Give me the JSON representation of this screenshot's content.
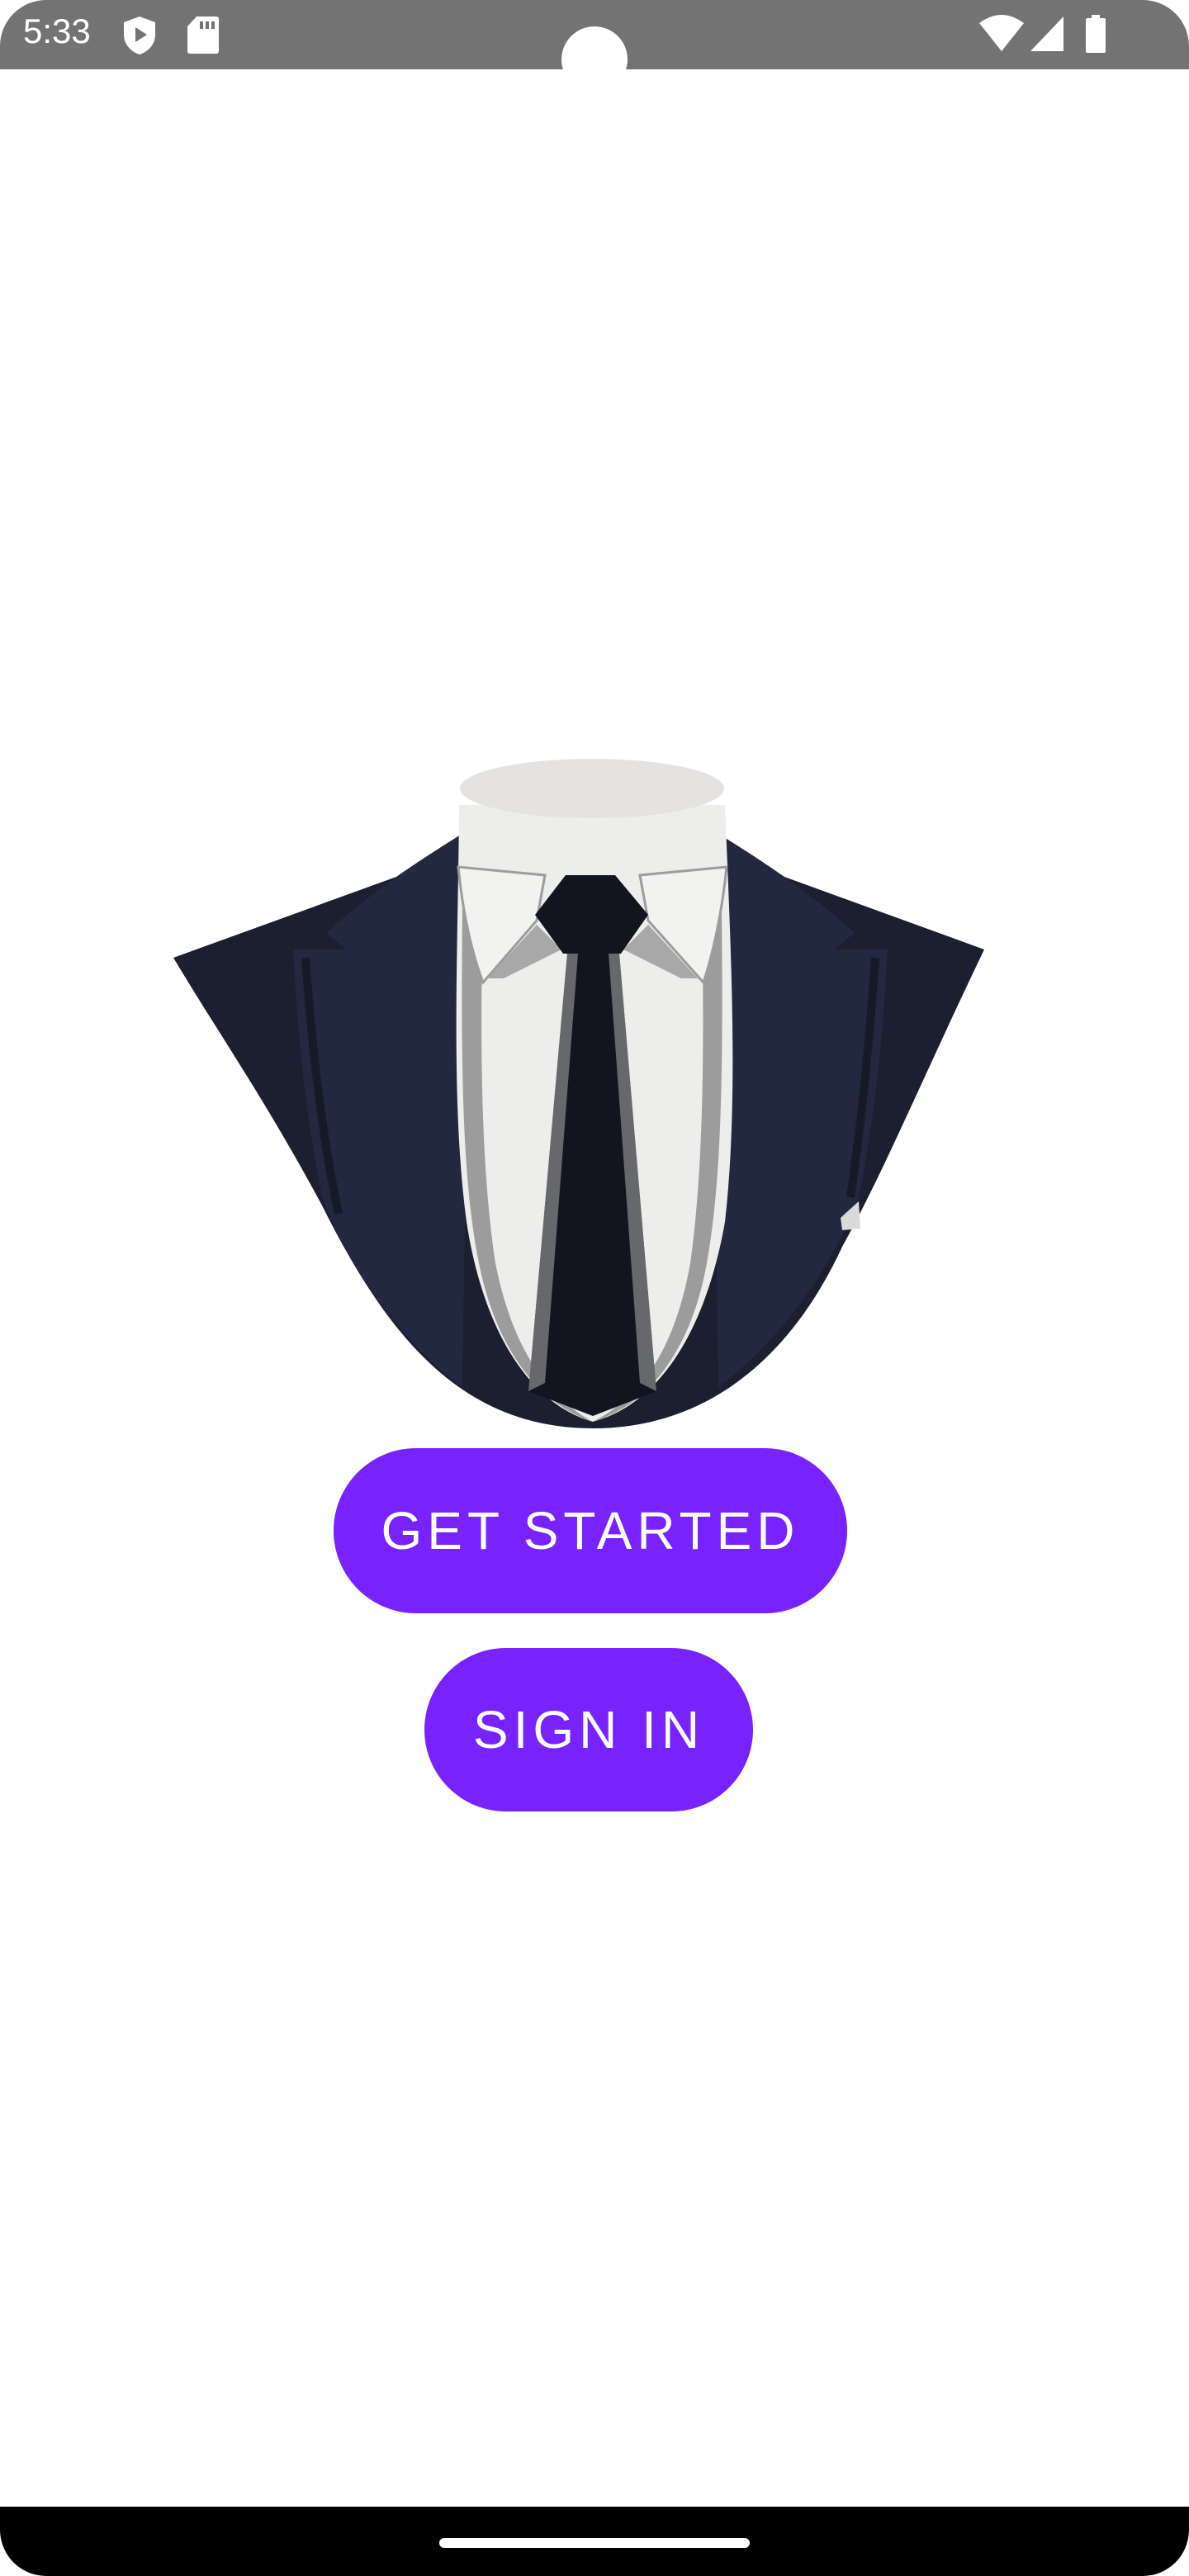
{
  "status_bar": {
    "time": "5:33",
    "icons": [
      "shield-play-icon",
      "sd-card-icon",
      "wifi-icon",
      "signal-icon",
      "battery-icon"
    ]
  },
  "illustration": {
    "subject": "suit-with-tie-illustration"
  },
  "actions": {
    "get_started_label": "GET STARTED",
    "sign_in_label": "SIGN IN"
  },
  "colors": {
    "accent": "#7722ff",
    "status_bar": "#737373",
    "suit": "#1e2335",
    "tie": "#12141f",
    "shirt": "#ededec"
  }
}
